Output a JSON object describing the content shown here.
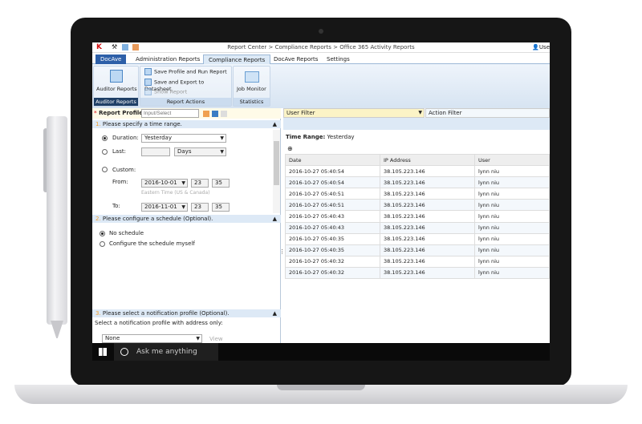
{
  "breadcrumb": "Report Center > Compliance Reports > Office 365 Activity Reports",
  "user_label": "Use",
  "tabs": [
    "DocAve",
    "Administration Reports",
    "Compliance Reports",
    "DocAve Reports",
    "Settings"
  ],
  "ribbon": {
    "auditor_reports": "Auditor Reports",
    "auditor_group": "Auditor Reports",
    "save_run": "Save Profile and Run Report",
    "save_export": "Save and Export to Datasheet",
    "show_report": "Show Report",
    "actions_group": "Report Actions",
    "job_monitor": "Job Monitor",
    "stats_group": "Statistics"
  },
  "profile": {
    "label": "Report Profile",
    "placeholder": "Input/Select"
  },
  "section1": {
    "num": "1.",
    "title": "Please specify a time range.",
    "duration_label": "Duration:",
    "duration_value": "Yesterday",
    "last_label": "Last:",
    "last_unit": "Days",
    "custom_label": "Custom:",
    "from_label": "From:",
    "from_date": "2016-10-01",
    "from_hour": "23",
    "from_min": "35",
    "timezone": "Eastern Time (US & Canada)",
    "to_label": "To:",
    "to_date": "2016-11-01",
    "to_hour": "23",
    "to_min": "35"
  },
  "section2": {
    "num": "2.",
    "title": "Please configure a schedule (Optional).",
    "opt1": "No schedule",
    "opt2": "Configure the schedule myself"
  },
  "section3": {
    "num": "3.",
    "title": "Please select a notification profile (Optional).",
    "desc": "Select a notification profile with address only:",
    "value": "None",
    "view": "View"
  },
  "filters": {
    "user": "User Filter",
    "action": "Action Filter"
  },
  "time_range": {
    "label": "Time Range:",
    "value": "Yesterday"
  },
  "table": {
    "headers": [
      "Date",
      "IP Address",
      "User"
    ],
    "rows": [
      [
        "2016-10-27 05:40:54",
        "38.105.223.146",
        "lynn niu"
      ],
      [
        "2016-10-27 05:40:54",
        "38.105.223.146",
        "lynn niu"
      ],
      [
        "2016-10-27 05:40:51",
        "38.105.223.146",
        "lynn niu"
      ],
      [
        "2016-10-27 05:40:51",
        "38.105.223.146",
        "lynn niu"
      ],
      [
        "2016-10-27 05:40:43",
        "38.105.223.146",
        "lynn niu"
      ],
      [
        "2016-10-27 05:40:43",
        "38.105.223.146",
        "lynn niu"
      ],
      [
        "2016-10-27 05:40:35",
        "38.105.223.146",
        "lynn niu"
      ],
      [
        "2016-10-27 05:40:35",
        "38.105.223.146",
        "lynn niu"
      ],
      [
        "2016-10-27 05:40:32",
        "38.105.223.146",
        "lynn niu"
      ],
      [
        "2016-10-27 05:40:32",
        "38.105.223.146",
        "lynn niu"
      ]
    ]
  },
  "taskbar": {
    "search": "Ask me anything"
  }
}
